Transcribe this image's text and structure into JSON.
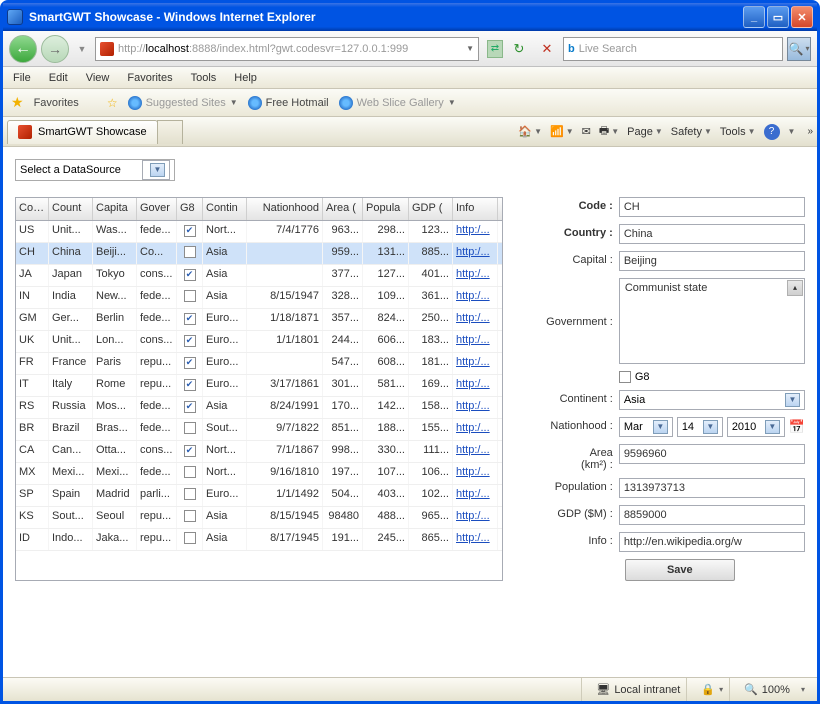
{
  "window": {
    "title": "SmartGWT Showcase - Windows Internet Explorer"
  },
  "address": {
    "prefix": "http://",
    "host": "localhost",
    "rest": ":8888/index.html?gwt.codesvr=127.0.0.1:999"
  },
  "search": {
    "placeholder": "Live Search"
  },
  "menu": [
    "File",
    "Edit",
    "View",
    "Favorites",
    "Tools",
    "Help"
  ],
  "favbar": {
    "fav": "Favorites",
    "suggested": "Suggested Sites",
    "hotmail": "Free Hotmail",
    "slice": "Web Slice Gallery"
  },
  "tab": {
    "label": "SmartGWT Showcase"
  },
  "tbr": {
    "page": "Page",
    "safety": "Safety",
    "tools": "Tools"
  },
  "ds_select": "Select a DataSource",
  "columns": [
    "Code",
    "Count",
    "Capita",
    "Gover",
    "G8",
    "Contin",
    "Nationhood",
    "Area (",
    "Popula",
    "GDP (",
    "Info"
  ],
  "rows": [
    {
      "code": "US",
      "country": "Unit...",
      "cap": "Was...",
      "gov": "fede...",
      "g8": true,
      "cont": "Nort...",
      "nh": "7/4/1776",
      "area": "963...",
      "pop": "298...",
      "gdp": "123...",
      "info": "http:/..."
    },
    {
      "code": "CH",
      "country": "China",
      "cap": "Beiji...",
      "gov": "Co...",
      "g8": false,
      "cont": "Asia",
      "nh": "",
      "area": "959...",
      "pop": "131...",
      "gdp": "885...",
      "info": "http:/..."
    },
    {
      "code": "JA",
      "country": "Japan",
      "cap": "Tokyo",
      "gov": "cons...",
      "g8": true,
      "cont": "Asia",
      "nh": "",
      "area": "377...",
      "pop": "127...",
      "gdp": "401...",
      "info": "http:/..."
    },
    {
      "code": "IN",
      "country": "India",
      "cap": "New...",
      "gov": "fede...",
      "g8": false,
      "cont": "Asia",
      "nh": "8/15/1947",
      "area": "328...",
      "pop": "109...",
      "gdp": "361...",
      "info": "http:/..."
    },
    {
      "code": "GM",
      "country": "Ger...",
      "cap": "Berlin",
      "gov": "fede...",
      "g8": true,
      "cont": "Euro...",
      "nh": "1/18/1871",
      "area": "357...",
      "pop": "824...",
      "gdp": "250...",
      "info": "http:/..."
    },
    {
      "code": "UK",
      "country": "Unit...",
      "cap": "Lon...",
      "gov": "cons...",
      "g8": true,
      "cont": "Euro...",
      "nh": "1/1/1801",
      "area": "244...",
      "pop": "606...",
      "gdp": "183...",
      "info": "http:/..."
    },
    {
      "code": "FR",
      "country": "France",
      "cap": "Paris",
      "gov": "repu...",
      "g8": true,
      "cont": "Euro...",
      "nh": "",
      "area": "547...",
      "pop": "608...",
      "gdp": "181...",
      "info": "http:/..."
    },
    {
      "code": "IT",
      "country": "Italy",
      "cap": "Rome",
      "gov": "repu...",
      "g8": true,
      "cont": "Euro...",
      "nh": "3/17/1861",
      "area": "301...",
      "pop": "581...",
      "gdp": "169...",
      "info": "http:/..."
    },
    {
      "code": "RS",
      "country": "Russia",
      "cap": "Mos...",
      "gov": "fede...",
      "g8": true,
      "cont": "Asia",
      "nh": "8/24/1991",
      "area": "170...",
      "pop": "142...",
      "gdp": "158...",
      "info": "http:/..."
    },
    {
      "code": "BR",
      "country": "Brazil",
      "cap": "Bras...",
      "gov": "fede...",
      "g8": false,
      "cont": "Sout...",
      "nh": "9/7/1822",
      "area": "851...",
      "pop": "188...",
      "gdp": "155...",
      "info": "http:/..."
    },
    {
      "code": "CA",
      "country": "Can...",
      "cap": "Otta...",
      "gov": "cons...",
      "g8": true,
      "cont": "Nort...",
      "nh": "7/1/1867",
      "area": "998...",
      "pop": "330...",
      "gdp": "111...",
      "info": "http:/..."
    },
    {
      "code": "MX",
      "country": "Mexi...",
      "cap": "Mexi...",
      "gov": "fede...",
      "g8": false,
      "cont": "Nort...",
      "nh": "9/16/1810",
      "area": "197...",
      "pop": "107...",
      "gdp": "106...",
      "info": "http:/..."
    },
    {
      "code": "SP",
      "country": "Spain",
      "cap": "Madrid",
      "gov": "parli...",
      "g8": false,
      "cont": "Euro...",
      "nh": "1/1/1492",
      "area": "504...",
      "pop": "403...",
      "gdp": "102...",
      "info": "http:/..."
    },
    {
      "code": "KS",
      "country": "Sout...",
      "cap": "Seoul",
      "gov": "repu...",
      "g8": false,
      "cont": "Asia",
      "nh": "8/15/1945",
      "area": "98480",
      "pop": "488...",
      "gdp": "965...",
      "info": "http:/..."
    },
    {
      "code": "ID",
      "country": "Indo...",
      "cap": "Jaka...",
      "gov": "repu...",
      "g8": false,
      "cont": "Asia",
      "nh": "8/17/1945",
      "area": "191...",
      "pop": "245...",
      "gdp": "865...",
      "info": "http:/..."
    }
  ],
  "form": {
    "code": {
      "label": "Code :",
      "value": "CH"
    },
    "country": {
      "label": "Country :",
      "value": "China"
    },
    "capital": {
      "label": "Capital :",
      "value": "Beijing"
    },
    "gov": {
      "label": "Government :",
      "value": "Communist state"
    },
    "g8": {
      "label": "G8",
      "checked": false
    },
    "continent": {
      "label": "Continent :",
      "value": "Asia"
    },
    "nh": {
      "label": "Nationhood :",
      "month": "Mar",
      "day": "14",
      "year": "2010"
    },
    "area": {
      "label": "Area (km²) :",
      "value": "9596960"
    },
    "pop": {
      "label": "Population :",
      "value": "1313973713"
    },
    "gdp": {
      "label": "GDP ($M) :",
      "value": "8859000"
    },
    "info": {
      "label": "Info :",
      "value": "http://en.wikipedia.org/w"
    },
    "save": "Save"
  },
  "status": {
    "zone": "Local intranet",
    "zoom": "100%"
  }
}
